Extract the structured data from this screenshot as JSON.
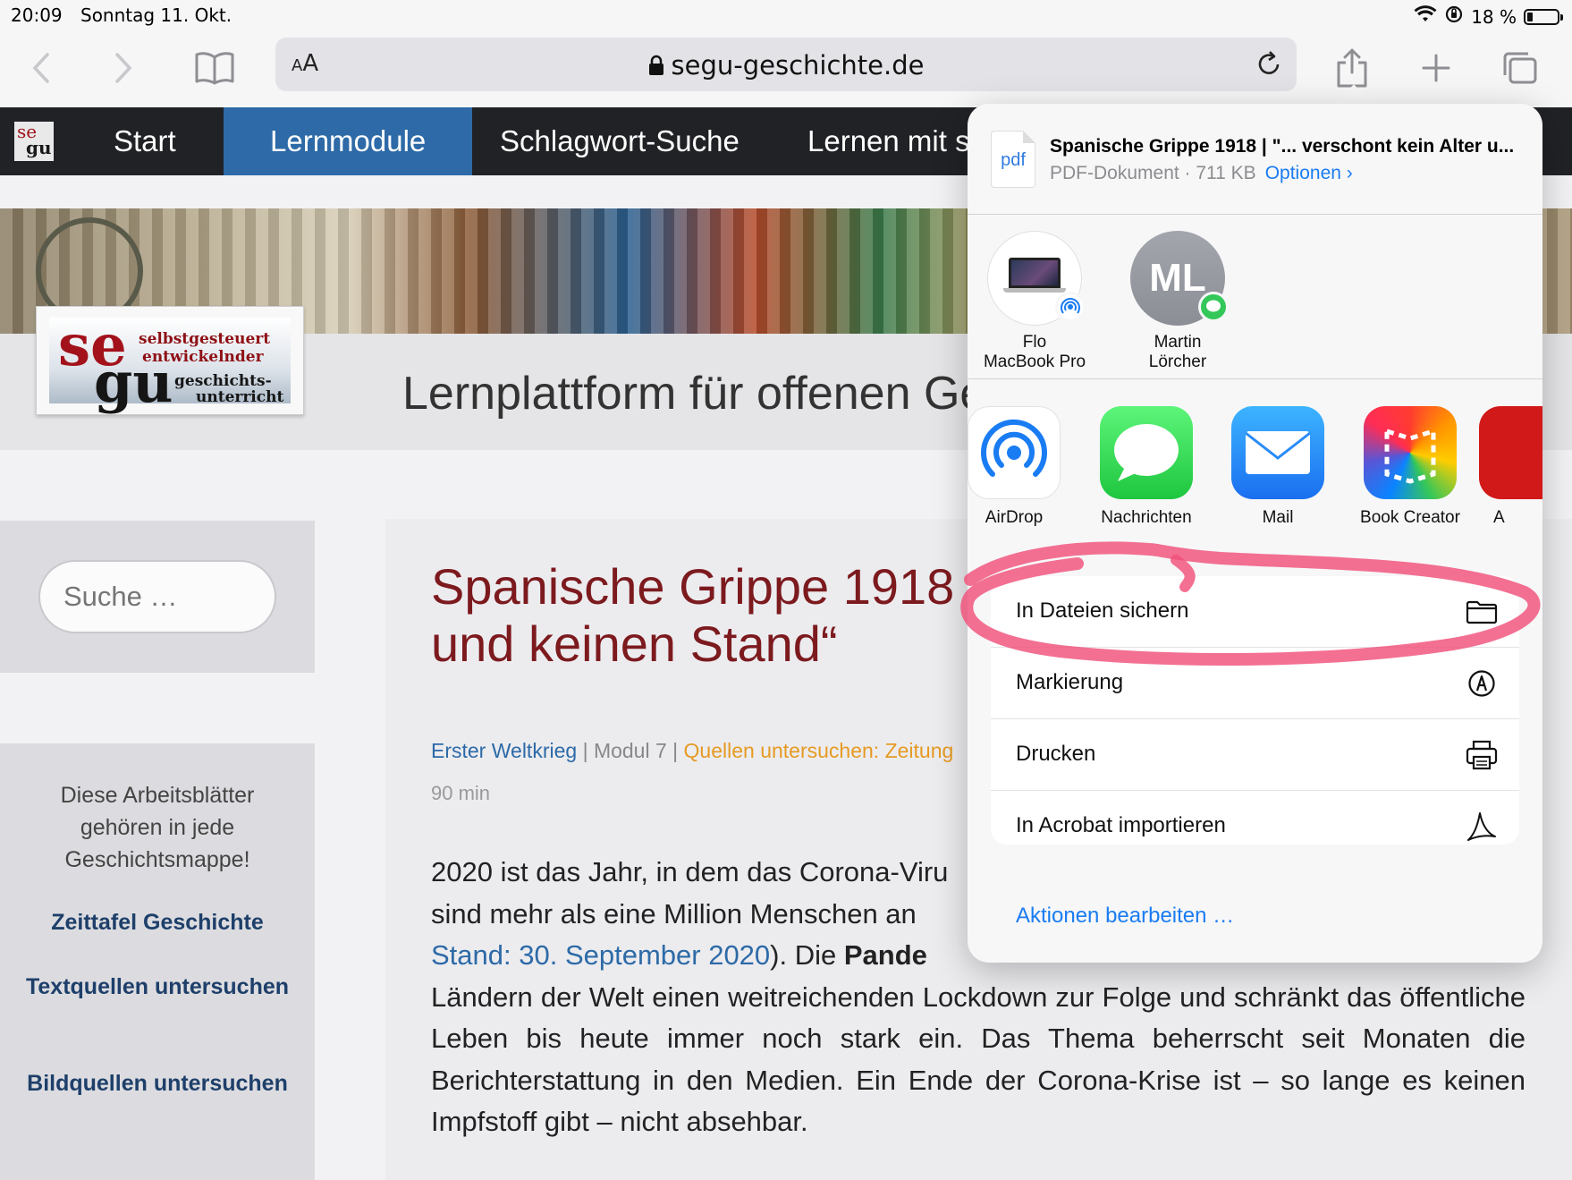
{
  "status_bar": {
    "time": "20:09",
    "date": "Sonntag 11. Okt.",
    "battery": "18 %"
  },
  "browser": {
    "aa_label": "AA",
    "url": "segu-geschichte.de"
  },
  "site_nav": {
    "logo_text_top": "se",
    "logo_text_bottom": "gu",
    "items": [
      {
        "label": "Start"
      },
      {
        "label": "Lernmodule"
      },
      {
        "label": "Schlagwort-Suche"
      },
      {
        "label": "Lernen mit se"
      }
    ]
  },
  "header": {
    "logo": {
      "se": "se",
      "gu": "gu",
      "line1": "selbstgesteuert",
      "line2": "entwickelnder",
      "line3": "geschichts-",
      "line4": "unterricht"
    },
    "title": "Lernplattform für offenen Ge"
  },
  "sidebar": {
    "search_placeholder": "Suche …",
    "intro": "Diese Arbeitsblätter gehören in jede Geschichtsmappe!",
    "links": [
      "Zeittafel Geschichte",
      "Textquellen untersuchen",
      "Bildquellen untersuchen"
    ]
  },
  "article": {
    "title_line1": "Spanische Grippe 1918 |",
    "title_line2": "und keinen Stand“",
    "meta_topic": "Erster Weltkrieg",
    "meta_sep": "|",
    "meta_module": "Modul 7",
    "meta_type": "Quellen untersuchen: Zeitung",
    "duration": "90 min",
    "body_1": "2020 ist das Jahr, in dem das Corona-Viru",
    "body_2": "sind mehr als eine Million Menschen an",
    "body_link": "Stand: 30. September 2020",
    "body_3": "). Die ",
    "body_bold": "Pande",
    "body_4": "Ländern der Welt einen weitreichenden Lockdown zur Folge und schränkt das öffentliche Leben bis heute immer noch stark ein. Das Thema beherrscht seit Monaten die Berichterstattung in den Medien. Ein Ende der Corona-Krise ist – so lange es keinen Impfstoff gibt – nicht absehbar."
  },
  "share_sheet": {
    "doc_thumb_label": "pdf",
    "doc_title": "Spanische Grippe 1918 | \"... verschont kein Alter u...",
    "doc_info": "PDF-Dokument · 711 KB",
    "options_label": "Optionen",
    "people": [
      {
        "line1": "Flo",
        "line2": "MacBook Pro"
      },
      {
        "initials": "ML",
        "line1": "Martin",
        "line2": "Lörcher"
      }
    ],
    "apps": [
      {
        "label": "AirDrop"
      },
      {
        "label": "Nachrichten"
      },
      {
        "label": "Mail"
      },
      {
        "label": "Book Creator"
      },
      {
        "label": "A"
      }
    ],
    "actions": [
      {
        "label": "In Dateien sichern",
        "icon": "folder-icon"
      },
      {
        "label": "Markierung",
        "icon": "markup-icon"
      },
      {
        "label": "Drucken",
        "icon": "printer-icon"
      },
      {
        "label": "In Acrobat importieren",
        "icon": "acrobat-icon"
      }
    ],
    "edit_actions": "Aktionen bearbeiten …"
  },
  "colors": {
    "nav_bg": "#212226",
    "nav_active": "#2d6aa7",
    "title_red": "#7c1a1e",
    "link_blue": "#2d6aa7",
    "ios_blue": "#1a7cf2",
    "highlight_pink": "#f0507a"
  }
}
